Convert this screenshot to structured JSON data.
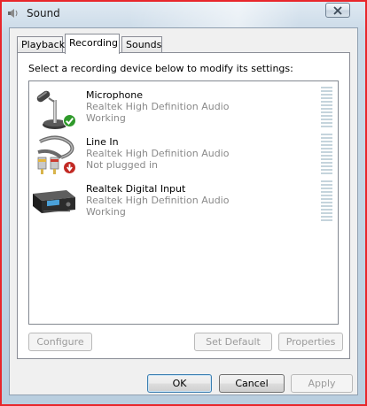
{
  "window": {
    "title": "Sound",
    "icon": "speaker-icon"
  },
  "tabs": [
    {
      "label": "Playback"
    },
    {
      "label": "Recording",
      "active": true
    },
    {
      "label": "Sounds"
    }
  ],
  "instruction": "Select a recording device below to modify its settings:",
  "devices": [
    {
      "name": "Microphone",
      "driver": "Realtek High Definition Audio",
      "status": "Working",
      "icon": "microphone-icon",
      "badge": "checkmark-badge-icon"
    },
    {
      "name": "Line In",
      "driver": "Realtek High Definition Audio",
      "status": "Not plugged in",
      "icon": "line-in-cable-icon",
      "badge": "unplugged-badge-icon"
    },
    {
      "name": "Realtek Digital Input",
      "driver": "Realtek High Definition Audio",
      "status": "Working",
      "icon": "digital-input-device-icon"
    }
  ],
  "panel_buttons": {
    "configure": "Configure",
    "set_default": "Set Default",
    "properties": "Properties"
  },
  "dialog_buttons": {
    "ok": "OK",
    "cancel": "Cancel",
    "apply": "Apply"
  },
  "colors": {
    "selection_border": "#e8262b",
    "meter_bar": "#c5d4dc",
    "status_text": "#8a8a8a"
  }
}
